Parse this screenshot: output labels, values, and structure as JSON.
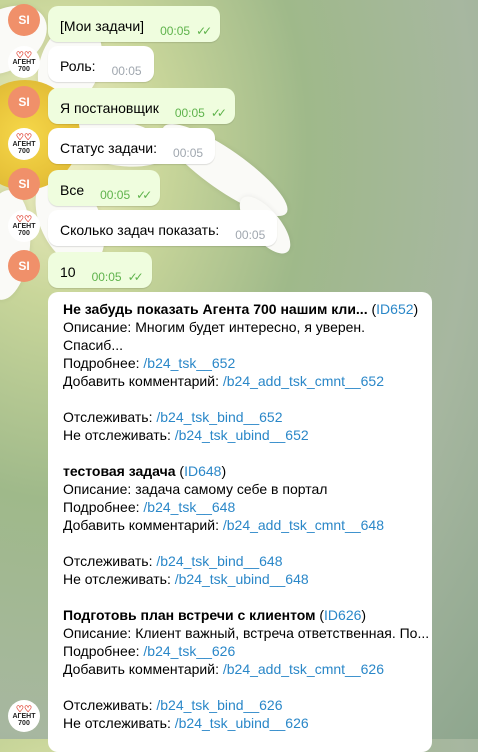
{
  "messages": [
    {
      "text": "[Мои задачи]",
      "time": "00:05",
      "dir": "out"
    },
    {
      "text": "Роль:",
      "time": "00:05",
      "dir": "in"
    },
    {
      "text": "Я постановщик",
      "time": "00:05",
      "dir": "out"
    },
    {
      "text": "Статус задачи:",
      "time": "00:05",
      "dir": "in"
    },
    {
      "text": "Все",
      "time": "00:05",
      "dir": "out"
    },
    {
      "text": "Сколько задач показать:",
      "time": "00:05",
      "dir": "in"
    },
    {
      "text": "10",
      "time": "00:05",
      "dir": "out"
    }
  ],
  "avatars": {
    "si": "SI",
    "logo_top": "♡♡",
    "logo_line1": "АГЕНТ",
    "logo_line2": "700"
  },
  "tasks": [
    {
      "title": "Не забудь показать Агента 700 нашим кли...",
      "id_prefix": " (",
      "id": "ID652",
      "id_suffix": ")",
      "desc_label": "Описание: ",
      "desc": "Многим будет интересно, я уверен.",
      "desc2": "Спасиб...",
      "more_label": "Подробнее: ",
      "more_link": "/b24_tsk__652",
      "comment_label": "Добавить комментарий: ",
      "comment_link": "/b24_add_tsk_cmnt__652",
      "bind_label": "Отслеживать: ",
      "bind_link": "/b24_tsk_bind__652",
      "ubind_label": "Не отслеживать: ",
      "ubind_link": "/b24_tsk_ubind__652"
    },
    {
      "title": "тестовая задача",
      "id_prefix": " (",
      "id": "ID648",
      "id_suffix": ")",
      "desc_label": "Описание: ",
      "desc": "задача самому себе в портал",
      "more_label": "Подробнее: ",
      "more_link": "/b24_tsk__648",
      "comment_label": "Добавить комментарий: ",
      "comment_link": "/b24_add_tsk_cmnt__648",
      "bind_label": "Отслеживать: ",
      "bind_link": "/b24_tsk_bind__648",
      "ubind_label": "Не отслеживать: ",
      "ubind_link": "/b24_tsk_ubind__648"
    },
    {
      "title": "Подготовь план встречи с клиентом",
      "id_prefix": " (",
      "id": "ID626",
      "id_suffix": ")",
      "desc_label": "Описание: ",
      "desc": "Клиент важный, встреча ответственная. По...",
      "more_label": "Подробнее: ",
      "more_link": "/b24_tsk__626",
      "comment_label": "Добавить комментарий: ",
      "comment_link": "/b24_add_tsk_cmnt__626",
      "bind_label": "Отслеживать: ",
      "bind_link": "/b24_tsk_bind__626",
      "ubind_label": "Не отслеживать: ",
      "ubind_link": "/b24_tsk_ubind__626"
    }
  ],
  "colors": {
    "out_bubble": "#effdde",
    "in_bubble": "#ffffff",
    "link": "#2a87c8",
    "si_avatar": "#f0906a",
    "check": "#5fb34c"
  }
}
